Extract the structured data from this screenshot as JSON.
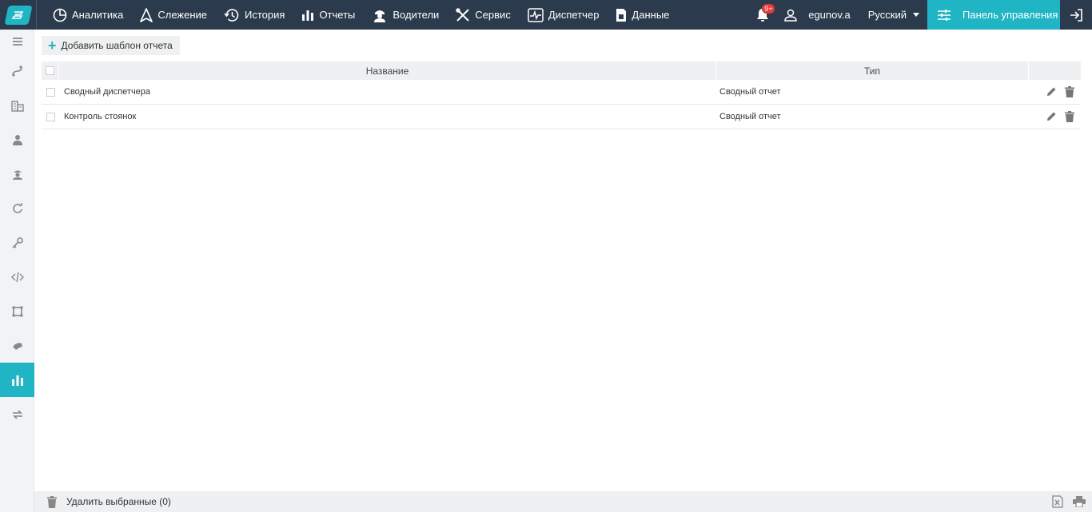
{
  "nav": {
    "items": [
      {
        "label": "Аналитика",
        "icon": "pie-chart-icon"
      },
      {
        "label": "Слежение",
        "icon": "navigation-arrow-icon"
      },
      {
        "label": "История",
        "icon": "history-icon"
      },
      {
        "label": "Отчеты",
        "icon": "bar-chart-icon"
      },
      {
        "label": "Водители",
        "icon": "driver-icon"
      },
      {
        "label": "Сервис",
        "icon": "tools-icon"
      },
      {
        "label": "Диспетчер",
        "icon": "pulse-icon"
      },
      {
        "label": "Данные",
        "icon": "sim-card-icon"
      }
    ]
  },
  "header": {
    "notifications_badge": "9+",
    "username": "egunov.a",
    "language": "Русский",
    "control_panel_label": "Панель управления"
  },
  "toolbar": {
    "add_template_label": "Добавить шаблон отчета"
  },
  "table": {
    "columns": [
      "Название",
      "Тип"
    ],
    "rows": [
      {
        "name": "Сводный диспетчера",
        "type": "Сводный отчет"
      },
      {
        "name": "Контроль стоянок",
        "type": "Сводный отчет"
      }
    ]
  },
  "footer": {
    "delete_selected_label": "Удалить выбранные (0)"
  },
  "colors": {
    "accent": "#1fb5c4",
    "topbar": "#2b3a4c",
    "sidebar": "#f2f3f5"
  }
}
